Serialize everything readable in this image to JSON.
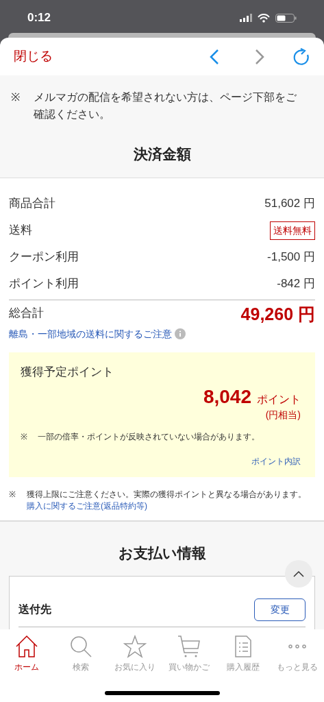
{
  "status_bar": {
    "time": "0:12"
  },
  "toolbar": {
    "close": "閉じる",
    "back_enabled": true,
    "forward_enabled": false
  },
  "notice": {
    "mark": "※",
    "text": "メルマガの配信を希望されない方は、ページ下部をご確認ください。"
  },
  "payment_summary": {
    "title": "決済金額",
    "rows": [
      {
        "kind": "amount",
        "label": "商品合計",
        "value": "51,602 円"
      },
      {
        "kind": "badge",
        "label": "送料",
        "value": "送料無料"
      },
      {
        "kind": "amount",
        "label": "クーポン利用",
        "value": "-1,500 円"
      },
      {
        "kind": "amount",
        "label": "ポイント利用",
        "value": "-842 円"
      }
    ],
    "total": {
      "label": "総合計",
      "value": "49,260 円"
    },
    "shipping_link": "離島・一部地域の送料に関するご注意"
  },
  "points": {
    "title": "獲得予定ポイント",
    "value": "8,042",
    "unit": "ポイント",
    "equivalent": "(円相当)",
    "note_mark": "※",
    "note": "一部の倍率・ポイントが反映されていない場合があります。",
    "breakdown_link": "ポイント内訳"
  },
  "caution": {
    "mark": "※",
    "text": "獲得上限にご注意ください。実際の獲得ポイントと異なる場合があります。",
    "link": "購入に関するご注意(返品特約等)"
  },
  "payment_info": {
    "title": "お支払い情報",
    "shipping_label": "送付先",
    "change_button": "変更"
  },
  "tab_bar": [
    {
      "kind": "home",
      "label": "ホーム",
      "selected": true
    },
    {
      "kind": "search",
      "label": "検索",
      "selected": false
    },
    {
      "kind": "star",
      "label": "お気に入り",
      "selected": false
    },
    {
      "kind": "cart",
      "label": "買い物かご",
      "selected": false
    },
    {
      "kind": "history",
      "label": "購入履歴",
      "selected": false
    },
    {
      "kind": "more",
      "label": "もっと見る",
      "selected": false
    }
  ]
}
